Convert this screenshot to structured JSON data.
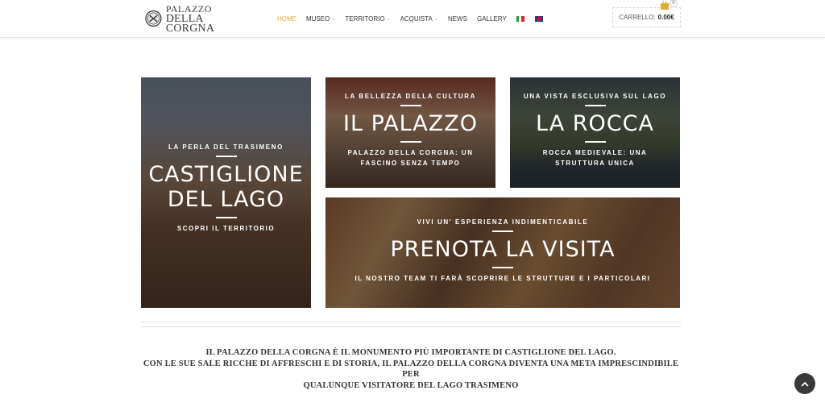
{
  "header": {
    "logo": {
      "line1": "PALAZZO",
      "line2": "DELLA CORGNA"
    },
    "nav": [
      {
        "label": "HOME",
        "active": true,
        "dropdown": false
      },
      {
        "label": "MUSEO",
        "active": false,
        "dropdown": true
      },
      {
        "label": "TERRITORIO",
        "active": false,
        "dropdown": true
      },
      {
        "label": "ACQUISTA",
        "active": false,
        "dropdown": true
      },
      {
        "label": "NEWS",
        "active": false,
        "dropdown": false
      },
      {
        "label": "GALLERY",
        "active": false,
        "dropdown": false
      }
    ],
    "languages": [
      "it-flag-icon",
      "uk-flag-icon"
    ],
    "cart": {
      "label": "CARRELLO:",
      "total": "0.00€",
      "count": "0"
    },
    "accent_color": "#e2a93b"
  },
  "tiles": {
    "castiglione": {
      "kicker": "LA PERLA DEL TRASIMENO",
      "title_line1": "CASTIGLIONE",
      "title_line2": "DEL LAGO",
      "sub": "SCOPRI IL TERRITORIO"
    },
    "palazzo": {
      "kicker": "LA BELLEZZA DELLA CULTURA",
      "title": "IL PALAZZO",
      "sub_line1": "PALAZZO DELLA CORGNA: UN",
      "sub_line2": "FASCINO SENZA TEMPO"
    },
    "rocca": {
      "kicker": "UNA VISTA ESCLUSIVA SUL LAGO",
      "title": "LA ROCCA",
      "sub_line1": "ROCCA MEDIEVALE: UNA",
      "sub_line2": "STRUTTURA UNICA"
    },
    "prenota": {
      "kicker": "VIVI UN' ESPERIENZA INDIMENTICABILE",
      "title": "PRENOTA LA VISITA",
      "sub": "IL NOSTRO TEAM TI FARÀ SCOPRIRE LE STRUTTURE E I PARTICOLARI"
    }
  },
  "intro": {
    "line1": "IL PALAZZO DELLA CORGNA È IL MONUMENTO PIÙ IMPORTANTE DI CASTIGLIONE DEL LAGO.",
    "line2": "CON LE SUE SALE RICCHE DI AFFRESCHI E DI STORIA, IL PALAZZO DELLA CORGNA DIVENTA UNA META IMPRESCINDIBILE PER",
    "line3": "QUALUNQUE VISITATORE DEL LAGO TRASIMENO",
    "tick": "’"
  },
  "back_to_top": "chevron-up-icon"
}
